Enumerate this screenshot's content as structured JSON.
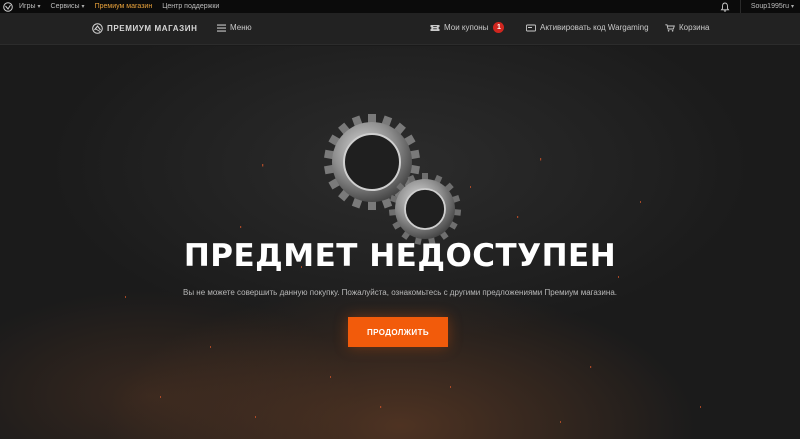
{
  "topbar": {
    "items": [
      {
        "label": "Игры",
        "dropdown": true
      },
      {
        "label": "Сервисы",
        "dropdown": true
      },
      {
        "label": "Премиум магазин",
        "active": true
      },
      {
        "label": "Центр поддержки"
      }
    ],
    "username": "Soup1995ru",
    "icons": {
      "logo": "wargaming-logo-icon",
      "notifications": "bell-icon",
      "user_menu": "chevron-down-icon"
    }
  },
  "shopnav": {
    "brand": "ПРЕМИУМ МАГАЗИН",
    "menu": "Меню",
    "coupons": {
      "label": "Мои купоны",
      "count": "1"
    },
    "activate": "Активировать код Wargaming",
    "cart": "Корзина",
    "icons": {
      "brand": "premium-shop-logo-icon",
      "menu": "hamburger-icon",
      "coupons": "coupon-icon",
      "activate": "code-card-icon",
      "cart": "cart-icon"
    }
  },
  "main": {
    "title": "ПРЕДМЕТ НЕДОСТУПЕН",
    "message": "Вы не можете совершить данную покупку. Пожалуйста, ознакомьтесь с другими предложениями Премиум магазина.",
    "continue_label": "ПРОДОЛЖИТЬ",
    "illustration": "gears-icon"
  },
  "colors": {
    "accent": "#f25b0b",
    "active_link": "#e9a23b",
    "badge": "#d0261f",
    "background": "#1a1a1a"
  }
}
